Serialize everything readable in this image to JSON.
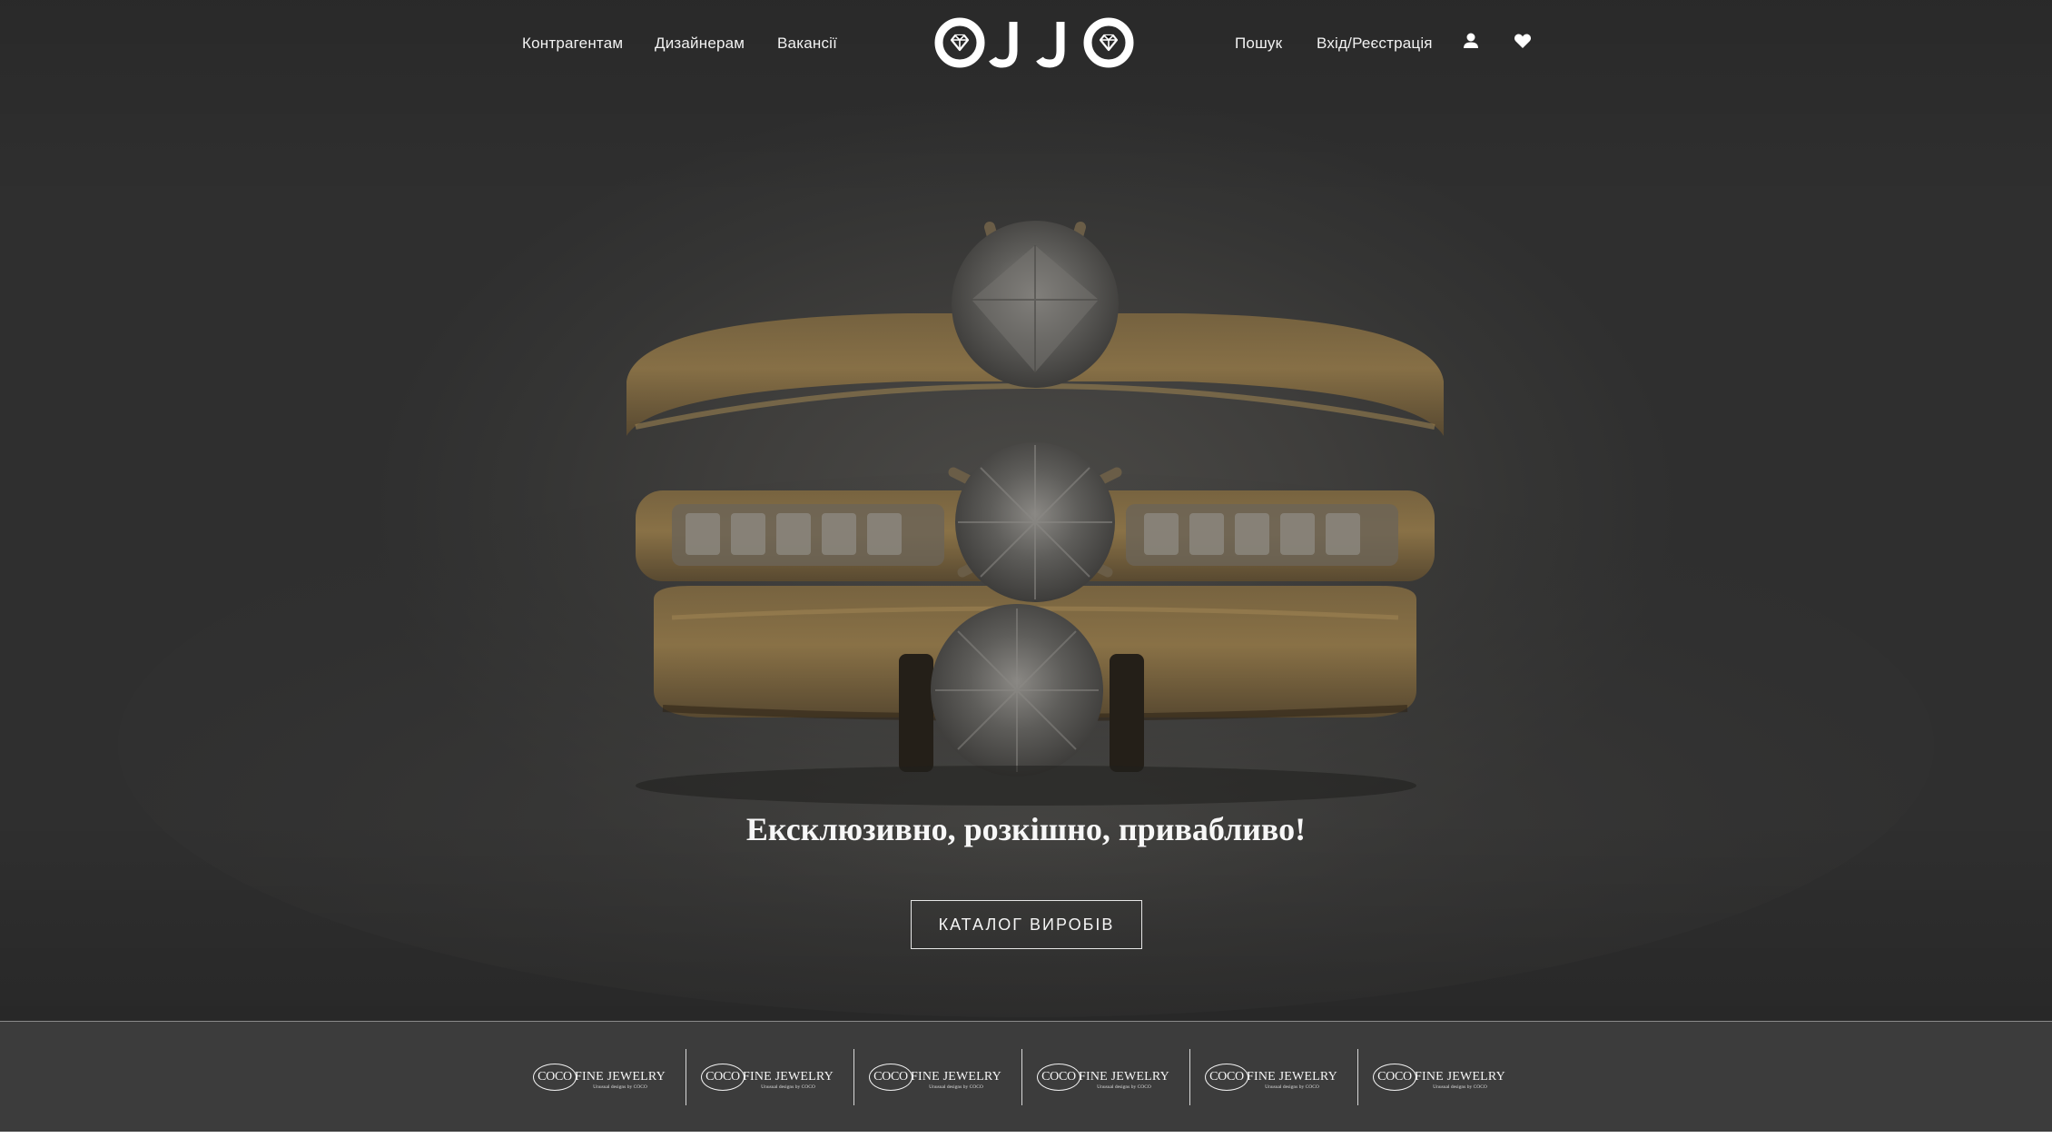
{
  "header": {
    "nav_left": [
      "Контрагентам",
      "Дизайнерам",
      "Вакансії"
    ],
    "logo_text": "OJJO",
    "nav_right": [
      "Пошук",
      "Вхід/Реєстрація"
    ],
    "icons": [
      "user-icon",
      "heart-icon"
    ]
  },
  "hero": {
    "image": "gold-diamond-rings-stack",
    "tagline": "Ексклюзивно, розкішно, привабливо!",
    "cta_label": "КАТАЛОГ ВИРОБІВ"
  },
  "brands": {
    "items": [
      {
        "oval": "COCO",
        "name": "FINE JEWELRY",
        "sub": "Unusual designs by COCO"
      },
      {
        "oval": "COCO",
        "name": "FINE JEWELRY",
        "sub": "Unusual designs by COCO"
      },
      {
        "oval": "COCO",
        "name": "FINE JEWELRY",
        "sub": "Unusual designs by COCO"
      },
      {
        "oval": "COCO",
        "name": "FINE JEWELRY",
        "sub": "Unusual designs by COCO"
      },
      {
        "oval": "COCO",
        "name": "FINE JEWELRY",
        "sub": "Unusual designs by COCO"
      },
      {
        "oval": "COCO",
        "name": "FINE JEWELRY",
        "sub": "Unusual designs by COCO"
      }
    ]
  },
  "colors": {
    "overlay": "#3a3a3a",
    "text": "#f5f5f5",
    "gold": "#8a7245"
  }
}
